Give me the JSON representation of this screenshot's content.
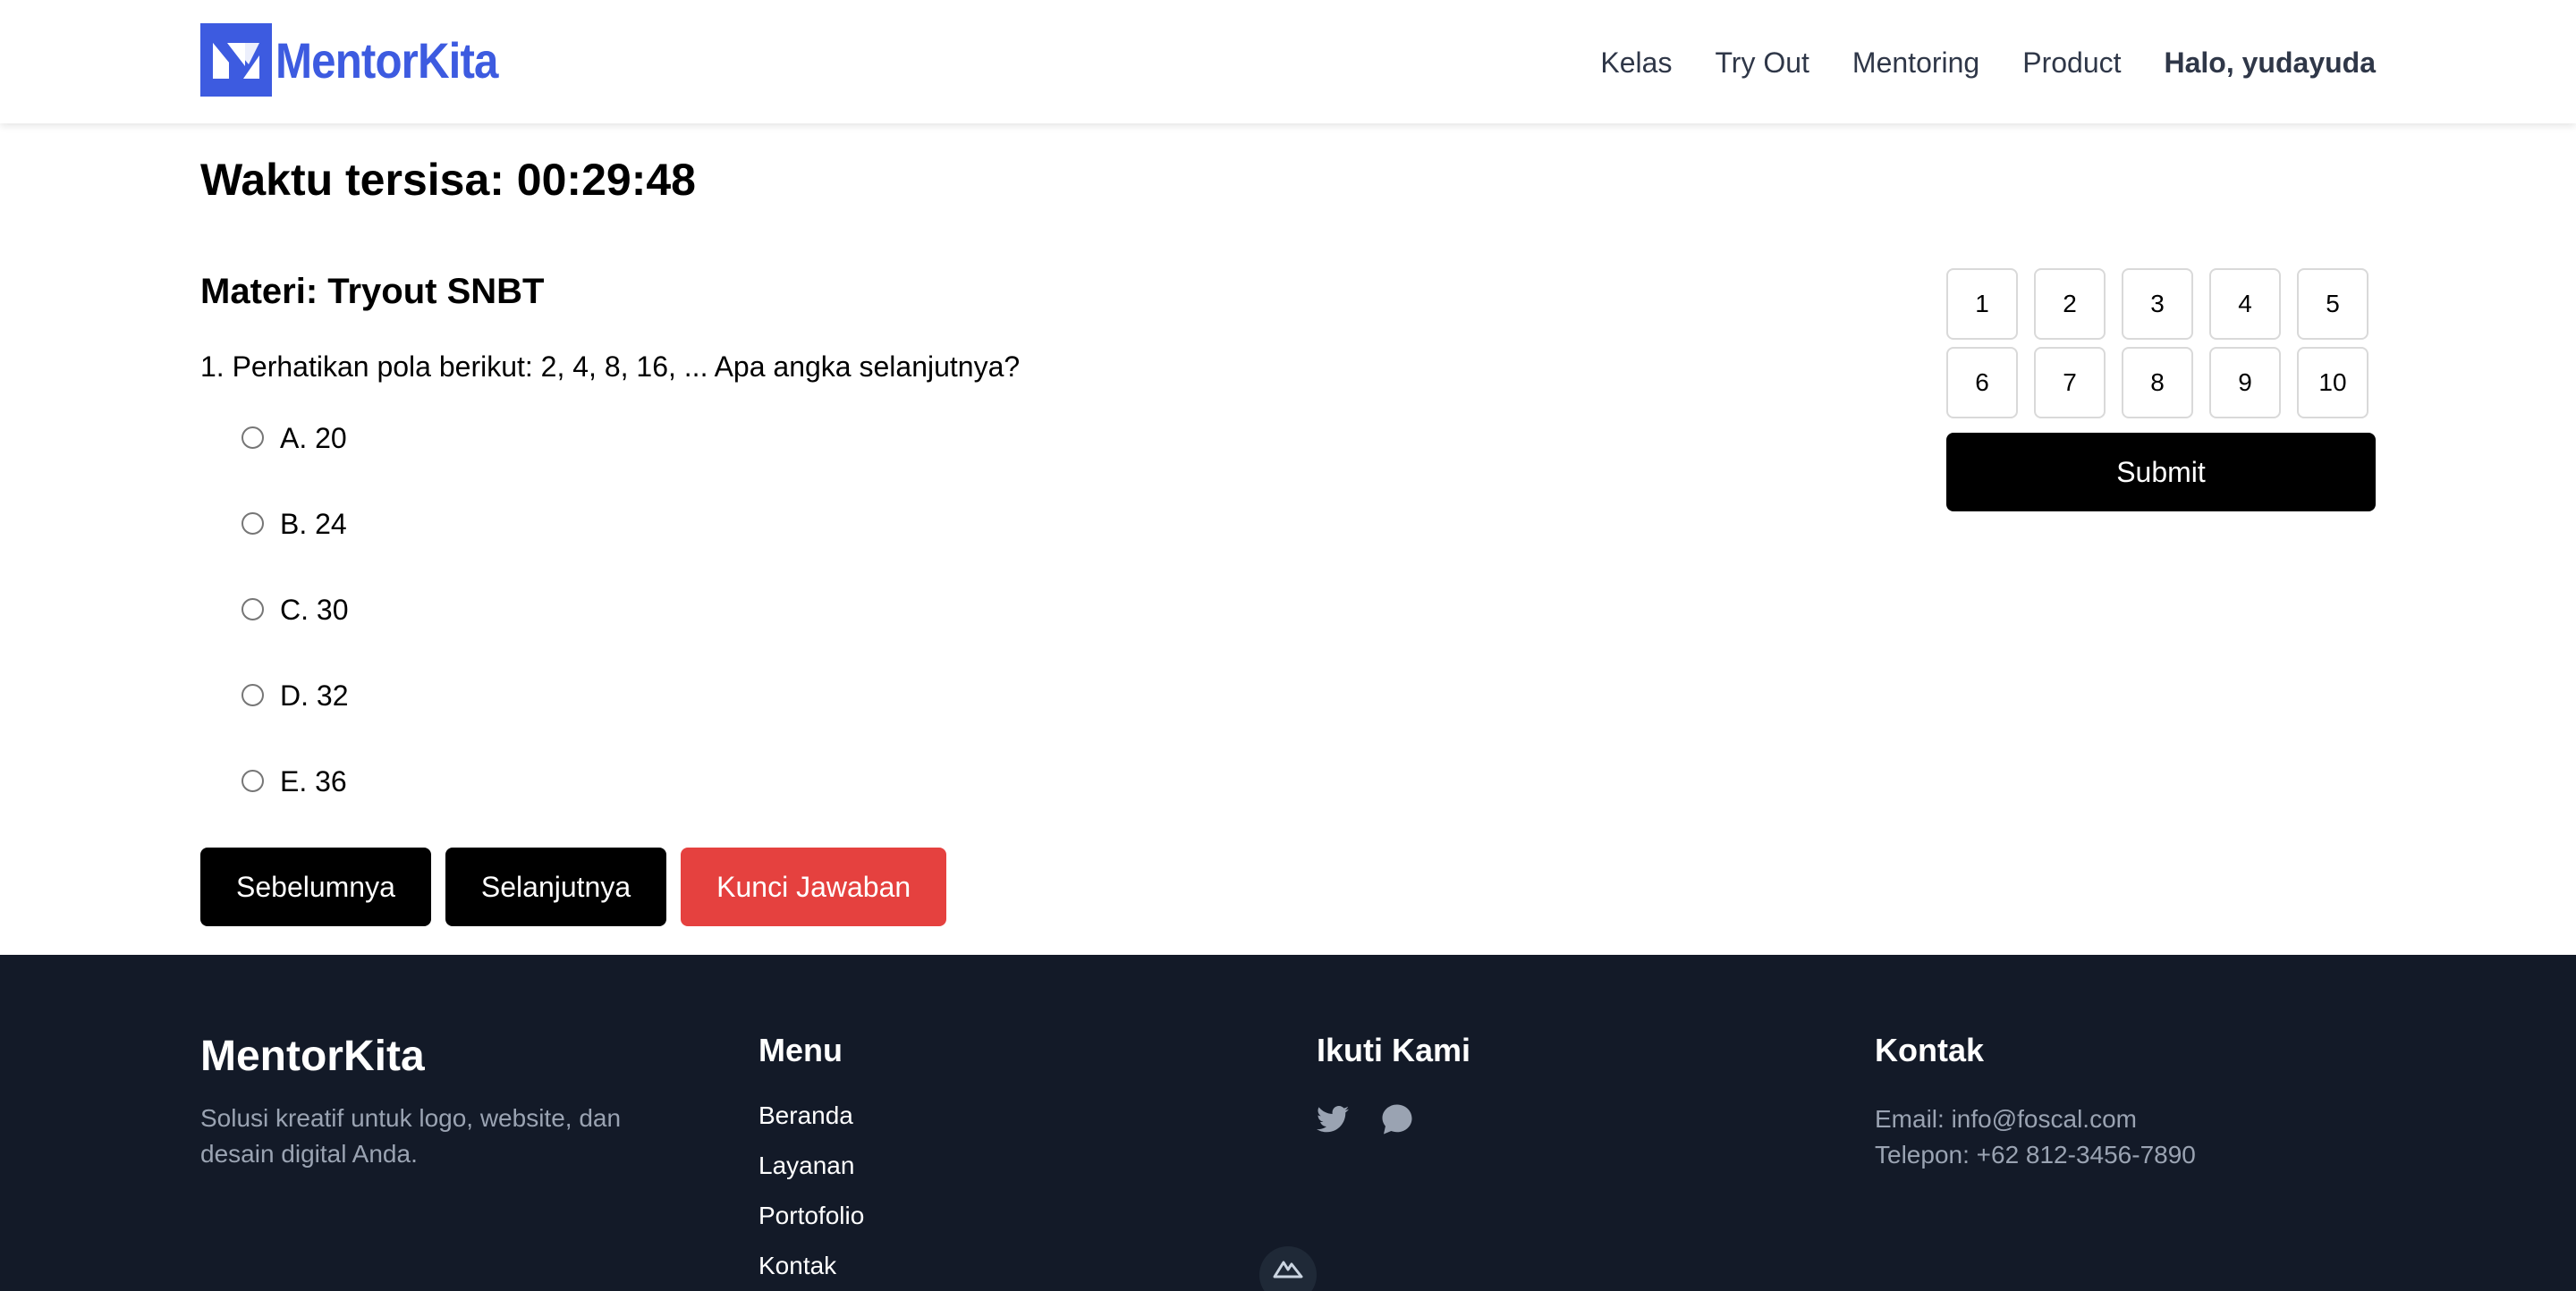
{
  "header": {
    "brand": "MentorKita",
    "nav": [
      "Kelas",
      "Try Out",
      "Mentoring",
      "Product"
    ],
    "user": "Halo, yudayuda"
  },
  "quiz": {
    "timer": "Waktu tersisa: 00:29:48",
    "subject": "Materi: Tryout SNBT",
    "question": "1. Perhatikan pola berikut: 2, 4, 8, 16, ... Apa angka selanjutnya?",
    "options": [
      "A. 20",
      "B. 24",
      "C. 30",
      "D. 32",
      "E. 36"
    ],
    "buttons": {
      "prev": "Sebelumnya",
      "next": "Selanjutnya",
      "key": "Kunci Jawaban"
    },
    "numbers": [
      "1",
      "2",
      "3",
      "4",
      "5",
      "6",
      "7",
      "8",
      "9",
      "10"
    ],
    "submit": "Submit"
  },
  "footer": {
    "brand": "MentorKita",
    "description": "Solusi kreatif untuk logo, website, dan desain digital Anda.",
    "menu_title": "Menu",
    "menu": [
      "Beranda",
      "Layanan",
      "Portofolio",
      "Kontak"
    ],
    "follow_title": "Ikuti Kami",
    "social_icons": [
      "twitter-icon",
      "chat-bubble-icon"
    ],
    "contact_title": "Kontak",
    "email": "Email: info@foscal.com",
    "phone": "Telepon: +62 812-3456-7890"
  },
  "colors": {
    "brand_blue": "#3d5be0",
    "danger_red": "#e5413f",
    "footer_bg": "#131a28",
    "footer_muted": "#9aa3b2"
  }
}
